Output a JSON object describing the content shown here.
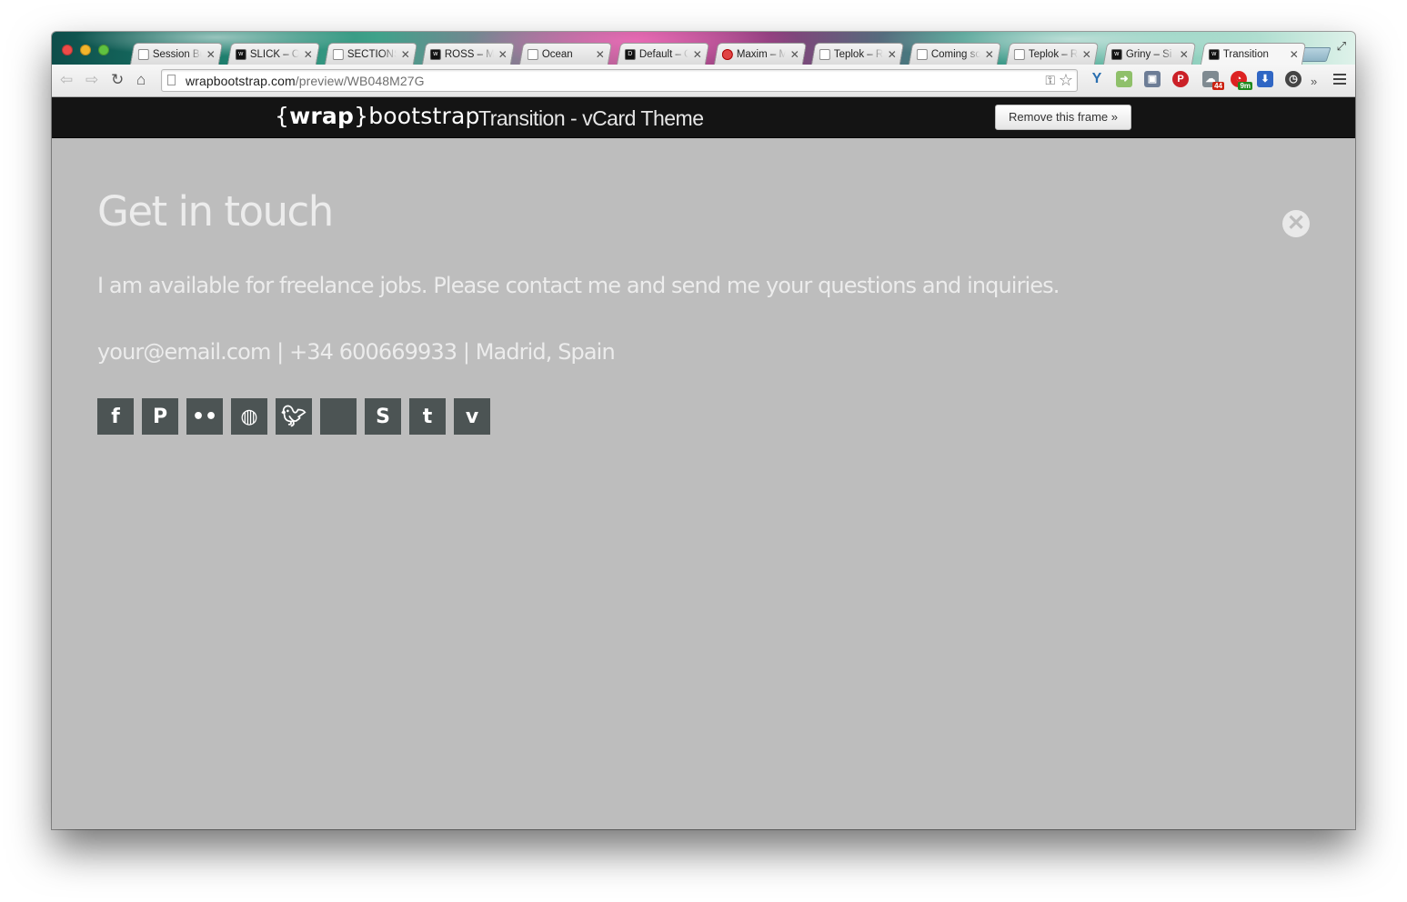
{
  "browser": {
    "tabs": [
      {
        "title": "Session Bu",
        "favicon": "session-icon"
      },
      {
        "title": "SLICK – Or",
        "favicon": "wrapbootstrap-icon"
      },
      {
        "title": "SECTIONS",
        "favicon": "document-icon"
      },
      {
        "title": "ROSS – Mu",
        "favicon": "wrapbootstrap-icon"
      },
      {
        "title": "Ocean",
        "favicon": "document-icon"
      },
      {
        "title": "Default – C",
        "favicon": "d-icon"
      },
      {
        "title": "Maxim – M",
        "favicon": "stop-icon"
      },
      {
        "title": "Teplok – R",
        "favicon": "document-icon"
      },
      {
        "title": "Coming so",
        "favicon": "document-icon"
      },
      {
        "title": "Teplok – R",
        "favicon": "document-icon"
      },
      {
        "title": "Griny – Si",
        "favicon": "wrapbootstrap-icon"
      },
      {
        "title": "Transition",
        "favicon": "wrapbootstrap-icon",
        "active": true
      }
    ],
    "address": {
      "domain": "wrapbootstrap.com",
      "path": "/preview/WB048M27G"
    },
    "extensions": {
      "badge_one": "44",
      "badge_two": "9m"
    }
  },
  "frame": {
    "logo_open": "{",
    "logo_wrap": "wrap",
    "logo_close": "}",
    "logo_rest": "bootstrap",
    "title": "Transition - vCard Theme",
    "remove_button": "Remove this frame »"
  },
  "page": {
    "heading": "Get in touch",
    "lead": "I am available for freelance jobs. Please contact me and send me your questions and inquiries.",
    "contact_line": "your@email.com | +34 600669933 | Madrid, Spain",
    "close_glyph": "✕",
    "socials": [
      {
        "name": "facebook-icon",
        "glyph": "f"
      },
      {
        "name": "pinterest-icon",
        "glyph": "P"
      },
      {
        "name": "flickr-icon",
        "glyph": "••"
      },
      {
        "name": "dribbble-icon",
        "glyph": "◍"
      },
      {
        "name": "twitter-icon",
        "glyph": "🐦︎"
      },
      {
        "name": "apple-icon",
        "glyph": ""
      },
      {
        "name": "skype-icon",
        "glyph": "S"
      },
      {
        "name": "tumblr-icon",
        "glyph": "t"
      },
      {
        "name": "vimeo-icon",
        "glyph": "v"
      }
    ]
  },
  "colors": {
    "page_bg": "#bdbdbd",
    "text": "#ececec",
    "social_bg": "#4c5454",
    "frame_bar": "#141414"
  }
}
